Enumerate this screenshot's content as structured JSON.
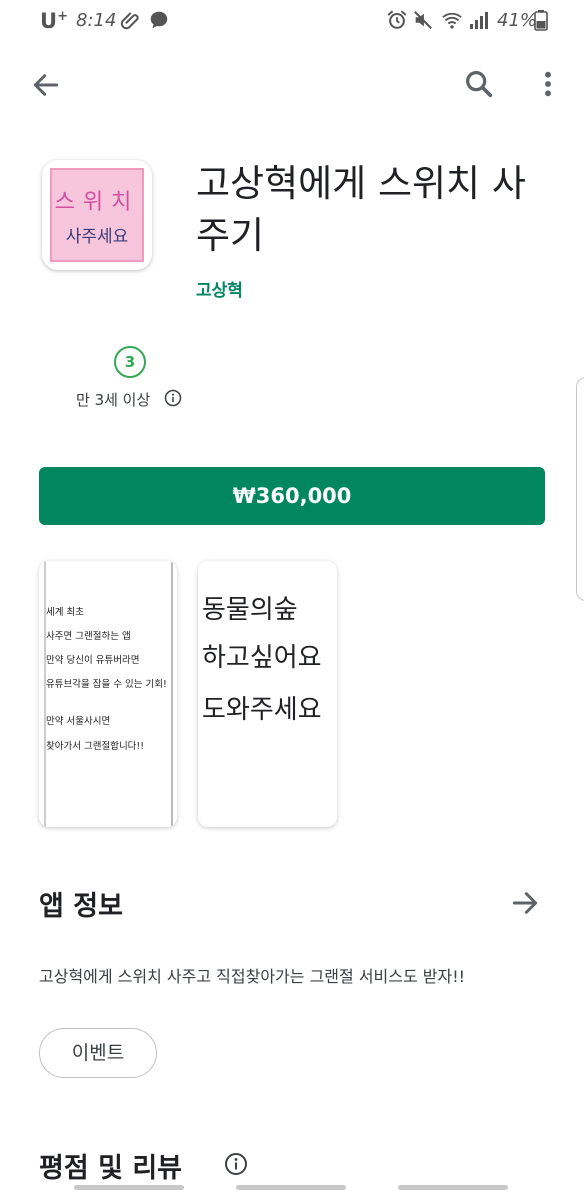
{
  "status_bar": {
    "carrier": "U",
    "carrier_sup": "+",
    "time": "8:14",
    "battery": "41%",
    "icons": [
      "paperclip-icon",
      "chat-bubble-icon",
      "alarm-icon",
      "mute-icon",
      "wifi-icon",
      "signal-icon",
      "battery-icon"
    ]
  },
  "toolbar": {
    "back_icon": "arrow-back-icon",
    "search_icon": "search-icon",
    "more_icon": "more-vert-icon"
  },
  "app": {
    "icon_line1": "스위치",
    "icon_line2": "사주세요",
    "title": "고상혁에게 스위치 사주기",
    "developer": "고상혁"
  },
  "rating": {
    "age_badge": "3",
    "age_label": "만 3세 이상"
  },
  "install": {
    "price": "₩360,000"
  },
  "screenshots": {
    "shot1_lines": [
      "세계 최초",
      "사주면 그랜절하는 앱",
      "만약 당신이 유튜버라면",
      "유튜브각을 잡을 수 있는 기회!",
      "",
      "만약 서울사시면",
      "찾아가서 그랜절합니다!!"
    ],
    "shot2_lines": [
      "동물의숲",
      "하고싶어요",
      "도와주세요"
    ]
  },
  "about": {
    "title": "앱 정보",
    "description": "고상혁에게 스위치 사주고 직접찾아가는 그랜절 서비스도 받자!!",
    "chip": "이벤트"
  },
  "ratings_section": {
    "title": "평점 및 리뷰"
  },
  "colors": {
    "accent": "#01875f",
    "age_badge": "#34a853",
    "icon_bg": "#f7c6dc"
  }
}
